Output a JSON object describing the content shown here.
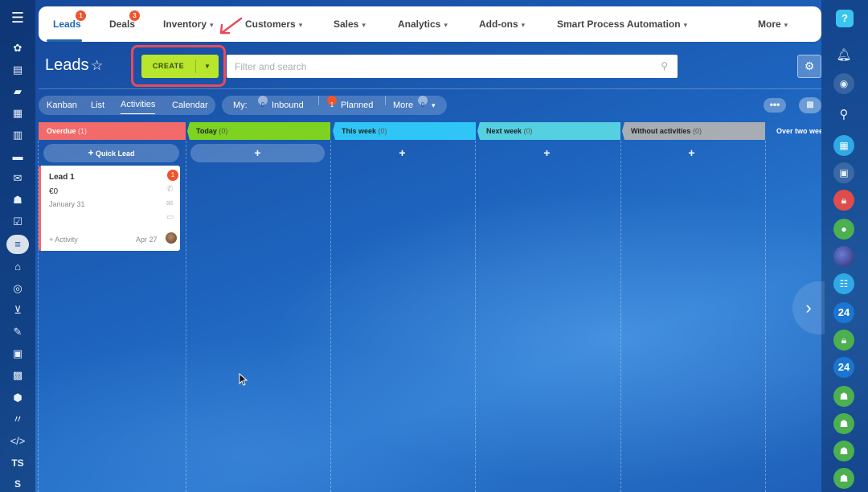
{
  "nav": {
    "items": [
      {
        "label": "Leads",
        "badge": "1"
      },
      {
        "label": "Deals",
        "badge": "3"
      },
      {
        "label": "Inventory"
      },
      {
        "label": "Customers"
      },
      {
        "label": "Sales"
      },
      {
        "label": "Analytics"
      },
      {
        "label": "Add-ons"
      },
      {
        "label": "Smart Process Automation"
      },
      {
        "label": "More"
      }
    ]
  },
  "header": {
    "title": "Leads",
    "create_label": "CREATE",
    "search_placeholder": "Filter and search"
  },
  "views": {
    "items": [
      "Kanban",
      "List",
      "Activities",
      "Calendar"
    ],
    "active": "Activities"
  },
  "filters": {
    "my_label": "My:",
    "inbound_count": "0",
    "inbound_label": "Inbound",
    "planned_count": "1",
    "planned_label": "Planned",
    "more_label": "More",
    "more_count": "0"
  },
  "columns": [
    {
      "title": "Overdue",
      "count": "(1)",
      "color": "#f26a6a"
    },
    {
      "title": "Today",
      "count": "(0)",
      "color": "#7ed321"
    },
    {
      "title": "This week",
      "count": "(0)",
      "color": "#2fc6f6"
    },
    {
      "title": "Next week",
      "count": "(0)",
      "color": "#55d0e0"
    },
    {
      "title": "Without activities",
      "count": "(0)",
      "color": "#a8adb4"
    },
    {
      "title": "Over two weeks",
      "count": ""
    }
  ],
  "quick_lead_label": "Quick Lead",
  "add_symbol": "+",
  "card": {
    "title": "Lead 1",
    "amount": "€0",
    "date": "January 31",
    "badge": "1",
    "activity_label": "+ Activity",
    "due": "Apr 27"
  },
  "left_bar": {
    "text_items": [
      "TS",
      "S"
    ]
  },
  "right_bar": {
    "help": "?",
    "badge_24": "24"
  },
  "colors": {
    "accent": "#2066b0",
    "create": "#b7e62c",
    "highlight": "#e84a5c",
    "badge": "#f0542c"
  }
}
